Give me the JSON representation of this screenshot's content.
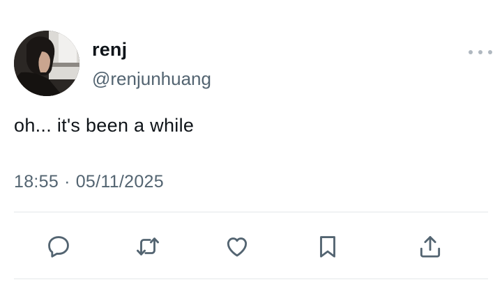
{
  "tweet": {
    "display_name": "renj",
    "handle": "@renjunhuang",
    "text": "oh... it's been a while",
    "time": "18:55",
    "separator": "·",
    "date": "05/11/2025"
  },
  "icons": {
    "avatar": "profile-photo",
    "more": "more-horizontal-icon",
    "reply": "reply-icon",
    "retweet": "retweet-icon",
    "like": "heart-icon",
    "bookmark": "bookmark-icon",
    "share": "share-icon"
  },
  "colors": {
    "text_primary": "#0f1419",
    "text_secondary": "#536471",
    "icon": "#536471",
    "divider": "#e3e7ea"
  }
}
